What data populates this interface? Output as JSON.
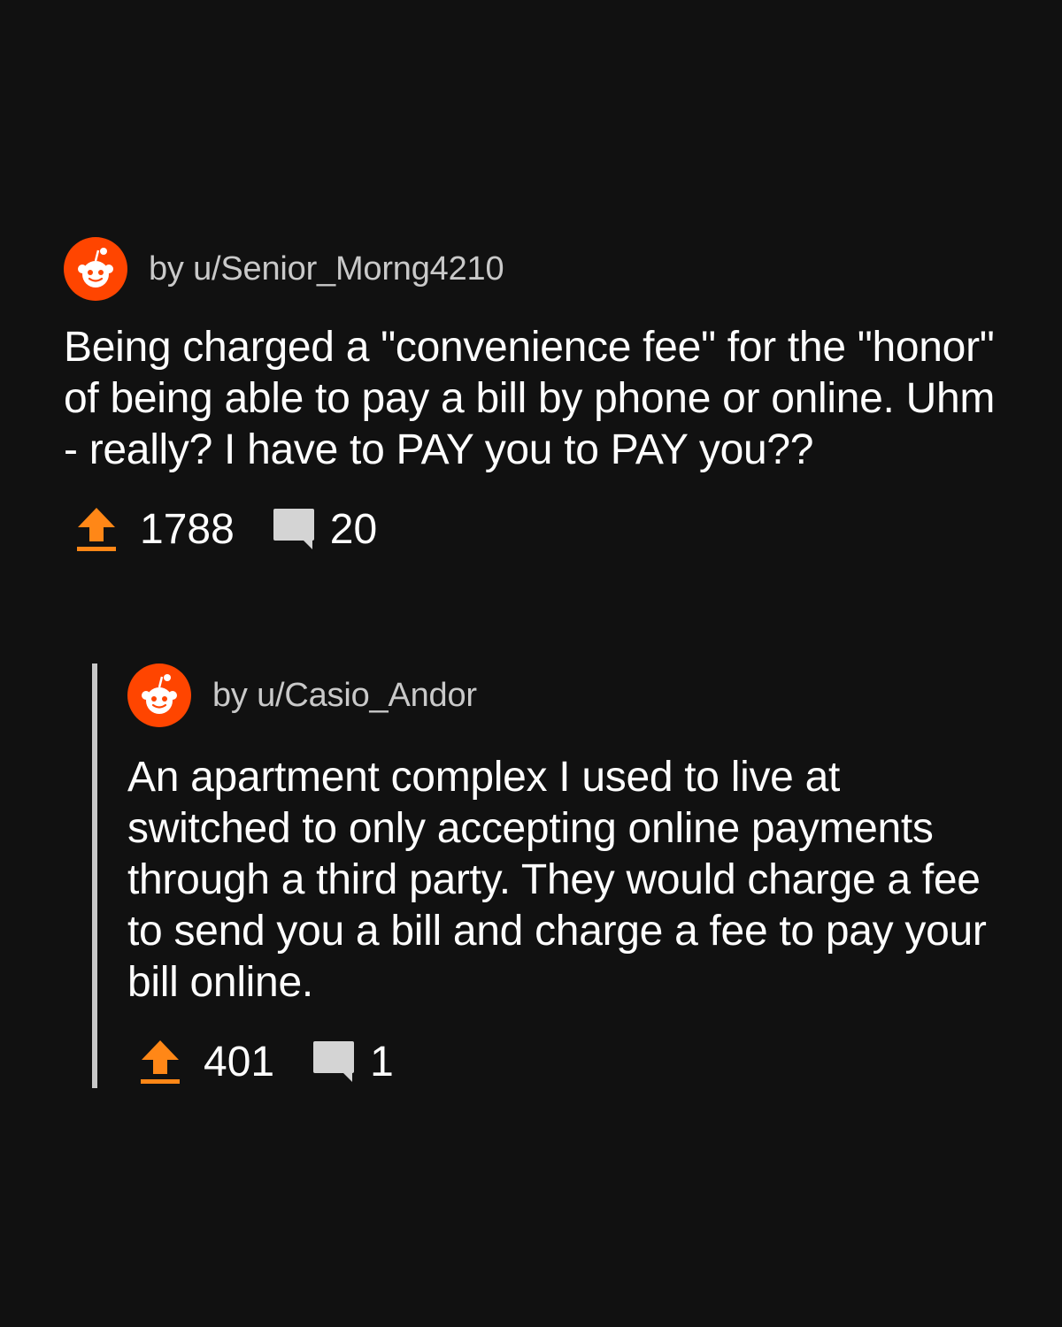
{
  "post": {
    "author": "by u/Senior_Morng4210",
    "title": "Being charged a \"convenience fee\" for the \"honor\" of being able to pay a bill by phone or online. Uhm - really? I have to PAY you to PAY you??",
    "upvotes": "1788",
    "comments": "20"
  },
  "reply": {
    "author": "by u/Casio_Andor",
    "body": "An apartment complex I used to live at switched to only accepting online payments through a third party. They would charge a fee to send you a bill and charge a fee to pay your bill online.",
    "upvotes": "401",
    "comments": "1"
  },
  "icons": {
    "avatar": "reddit-snoo-icon",
    "upvote": "upvote-arrow-icon",
    "comment": "comment-bubble-icon"
  },
  "colors": {
    "background": "#111111",
    "avatar": "#ff4500",
    "upvote": "#ff8717",
    "comment_icon": "#d4d4d4",
    "text": "#ffffff",
    "author_text": "#c9c9c9",
    "thread_line": "#c8c8c8"
  }
}
